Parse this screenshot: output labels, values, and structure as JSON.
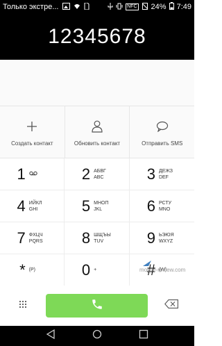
{
  "status_bar": {
    "notification_text": "Только экстре...",
    "battery": "24%",
    "time": "7:49",
    "icons": [
      "gallery-icon",
      "wifi-icon",
      "sim-icon",
      "usb-icon",
      "vibrate-icon",
      "nfc-icon",
      "no-sim-icon",
      "battery-icon"
    ]
  },
  "dialer": {
    "number": "12345678"
  },
  "actions": [
    {
      "label": "Создать контакт",
      "icon": "plus-icon"
    },
    {
      "label": "Обновить контакт",
      "icon": "person-icon"
    },
    {
      "label": "Отправить SMS",
      "icon": "message-icon"
    }
  ],
  "keypad": [
    {
      "digit": "1",
      "sub1": "",
      "sub2": "",
      "icon": "voicemail-icon"
    },
    {
      "digit": "2",
      "sub1": "АБВГ",
      "sub2": "ABC"
    },
    {
      "digit": "3",
      "sub1": "ДЕЖЗ",
      "sub2": "DEF"
    },
    {
      "digit": "4",
      "sub1": "ИЙКЛ",
      "sub2": "GHI"
    },
    {
      "digit": "5",
      "sub1": "МНОП",
      "sub2": "JKL"
    },
    {
      "digit": "6",
      "sub1": "РСТУ",
      "sub2": "MNO"
    },
    {
      "digit": "7",
      "sub1": "ФХЦЧ",
      "sub2": "PQRS"
    },
    {
      "digit": "8",
      "sub1": "ШЩЪЫ",
      "sub2": "TUV"
    },
    {
      "digit": "9",
      "sub1": "ЬЭЮЯ",
      "sub2": "WXYZ"
    },
    {
      "digit": "*",
      "sub1": "(P)",
      "sub2": ""
    },
    {
      "digit": "0",
      "sub1": "+",
      "sub2": ""
    },
    {
      "digit": "#",
      "sub1": "(W)",
      "sub2": ""
    }
  ],
  "watermark": "mobile-review.com",
  "colors": {
    "call_button": "#7ed957",
    "header_bg": "#000000",
    "accent_blue": "#3f7fbf"
  }
}
